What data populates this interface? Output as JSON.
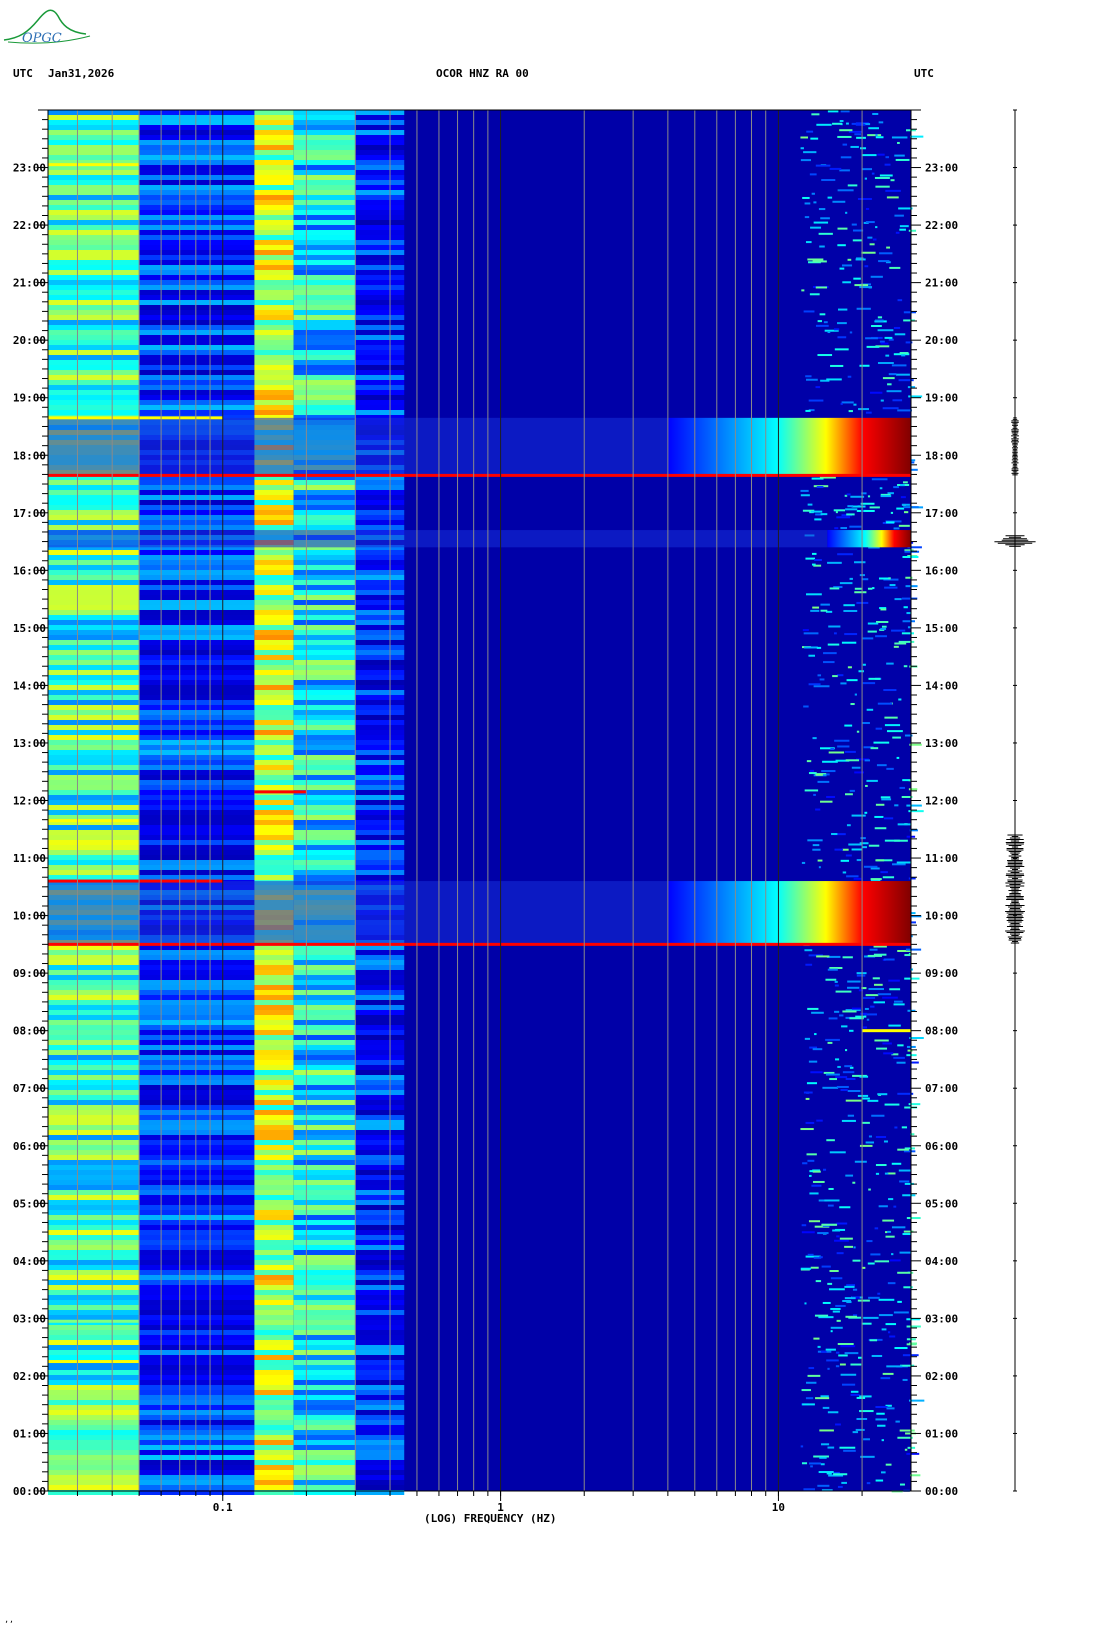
{
  "header": {
    "left_label": "UTC",
    "date": "Jan31,2026",
    "station": "OCOR HNZ RA 00",
    "right_label": "UTC"
  },
  "logo": {
    "text": "OPGC"
  },
  "footer_mark": "ʼʼ",
  "chart_data": {
    "type": "heatmap",
    "title": "OCOR HNZ RA 00",
    "xlabel": "(LOG) FREQUENCY (HZ)",
    "xscale": "log",
    "xlim": [
      0.0235,
      30
    ],
    "x_ticks": [
      {
        "value": 0.1,
        "label": "0.1"
      },
      {
        "value": 1,
        "label": "1"
      },
      {
        "value": 10,
        "label": "10"
      }
    ],
    "ylim": [
      0,
      24
    ],
    "y_ticks": [
      "00:00",
      "01:00",
      "02:00",
      "03:00",
      "04:00",
      "05:00",
      "06:00",
      "07:00",
      "08:00",
      "09:00",
      "10:00",
      "11:00",
      "12:00",
      "13:00",
      "14:00",
      "15:00",
      "16:00",
      "17:00",
      "18:00",
      "19:00",
      "20:00",
      "21:00",
      "22:00",
      "23:00"
    ],
    "colormap": [
      "#00008f",
      "#0000ff",
      "#00ffff",
      "#ffff00",
      "#ff0000",
      "#800000"
    ],
    "background_color": "#0000a8",
    "grid": true,
    "bands": [
      {
        "f_min": 0.0235,
        "f_max": 0.05,
        "level": 0.45
      },
      {
        "f_min": 0.05,
        "f_max": 0.13,
        "level": 0.22
      },
      {
        "f_min": 0.13,
        "f_max": 0.18,
        "level": 0.55
      },
      {
        "f_min": 0.18,
        "f_max": 0.3,
        "level": 0.4
      },
      {
        "f_min": 0.3,
        "f_max": 0.45,
        "level": 0.2
      }
    ],
    "events": [
      {
        "start": 9.5,
        "end": 10.6,
        "f_onset": 4,
        "peak": "dark-red"
      },
      {
        "start": 16.4,
        "end": 16.7,
        "f_onset": 15,
        "peak": "dark-red"
      },
      {
        "start": 17.65,
        "end": 18.65,
        "f_onset": 4,
        "peak": "dark-red"
      }
    ],
    "lines": [
      {
        "time": 2.25,
        "f_max": 0.05,
        "color": "#ffff00"
      },
      {
        "time": 2.95,
        "f_max": 0.05,
        "color": "#80ff80"
      },
      {
        "time": 8.0,
        "f_min": 20,
        "color": "#ffff00"
      },
      {
        "time": 9.5,
        "f_max": 30,
        "color": "#ff0000"
      },
      {
        "time": 10.6,
        "f_max": 0.1,
        "color": "#ff0000"
      },
      {
        "time": 11.65,
        "f_max": 0.05,
        "color": "#ffff00"
      },
      {
        "time": 12.15,
        "f_min": 0.13,
        "f_max": 0.2,
        "color": "#ff0000"
      },
      {
        "time": 17.65,
        "f_max": 30,
        "color": "#ff0000"
      },
      {
        "time": 18.65,
        "f_max": 0.1,
        "color": "#ffff00"
      },
      {
        "time": 23.05,
        "f_max": 0.05,
        "color": "#ffff00"
      }
    ]
  },
  "seismogram": {
    "events": [
      {
        "start": 9.5,
        "end": 11.4,
        "amplitude": 0.45
      },
      {
        "start": 16.4,
        "end": 16.6,
        "amplitude": 1.0
      },
      {
        "start": 17.65,
        "end": 18.65,
        "amplitude": 0.15
      }
    ]
  }
}
